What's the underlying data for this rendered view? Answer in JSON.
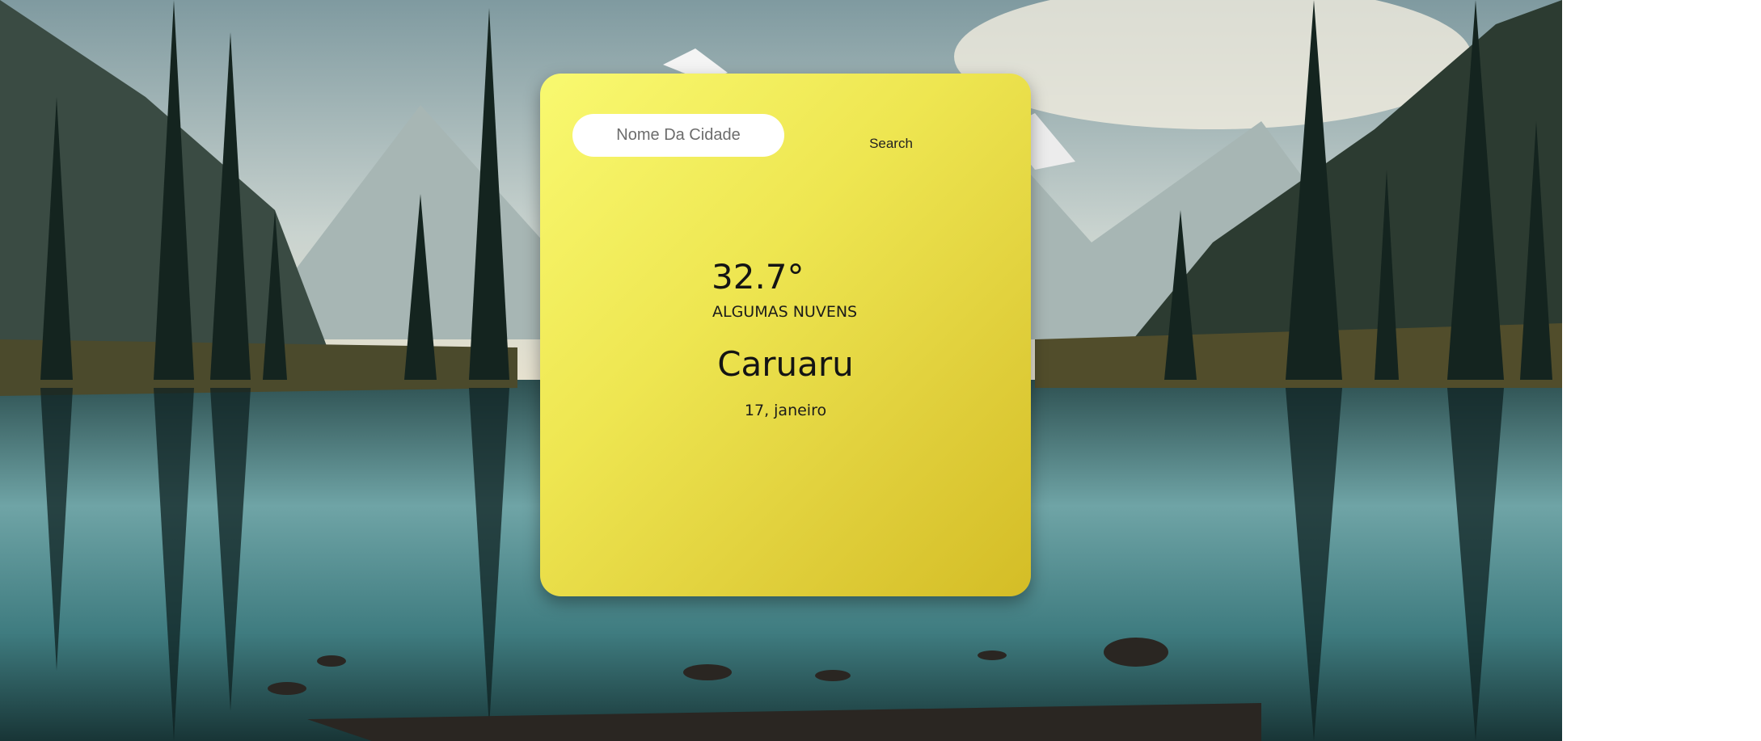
{
  "search": {
    "placeholder": "Nome Da Cidade",
    "value": "",
    "button_label": "Search"
  },
  "weather": {
    "temperature": "32.7°",
    "description": "ALGUMAS NUVENS",
    "city": "Caruaru",
    "date": "17, janeiro"
  },
  "colors": {
    "card_top": "#f9f970",
    "card_bottom": "#d4bd26",
    "input_bg": "#ffffff"
  }
}
